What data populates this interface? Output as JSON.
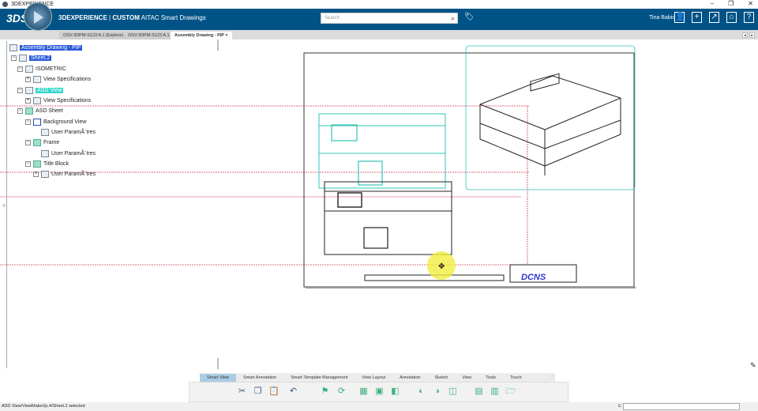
{
  "window": {
    "title": "3DEXPERIENCE",
    "min": "–",
    "restore": "❐",
    "close": "✕"
  },
  "app": {
    "brand": "3DEXPERIENCE",
    "separator": "|",
    "custom": "CUSTOM",
    "product": "AITAC Smart Drawings",
    "logo": "3DS"
  },
  "search": {
    "placeholder": "Search"
  },
  "user": {
    "name": "Tina Babic"
  },
  "tabs": [
    {
      "label": "OSV-3DPM-S123 A.1 (Explore)"
    },
    {
      "label": "OSV-3DPM-S123 A.1"
    },
    {
      "label": "Assembly Drawing - PIP",
      "close": "×"
    }
  ],
  "tree": [
    {
      "label": "Assembly Drawing - PIP"
    },
    {
      "label": "Sheet.2"
    },
    {
      "label": "ISOMETRIC"
    },
    {
      "label": "View Specifications"
    },
    {
      "label": "ASD View"
    },
    {
      "label": "View Specifications"
    },
    {
      "label": "ASD Sheet"
    },
    {
      "label": "Background View"
    },
    {
      "label": "User ParamÃ¨tres"
    },
    {
      "label": "Frame"
    },
    {
      "label": "User ParamÃ¨tres"
    },
    {
      "label": "Title Block"
    },
    {
      "label": "User ParamÃ¨tres"
    }
  ],
  "drawing": {
    "logo": "DCNS"
  },
  "toolbar": {
    "tabs": [
      "Smart View",
      "Smart Annotation",
      "Smart Template Management",
      "View Layout",
      "Annotation",
      "Sketch",
      "View",
      "Tools",
      "Touch"
    ],
    "active": "Smart View"
  },
  "status": {
    "message": "ASD View/ViewMakeUp.4/Sheet.2 selected",
    "command_label": "c:"
  },
  "colors": {
    "appbar": "#005386",
    "teal": "#33c4b8",
    "red": "#d04050",
    "selection": "#2a59d9"
  }
}
